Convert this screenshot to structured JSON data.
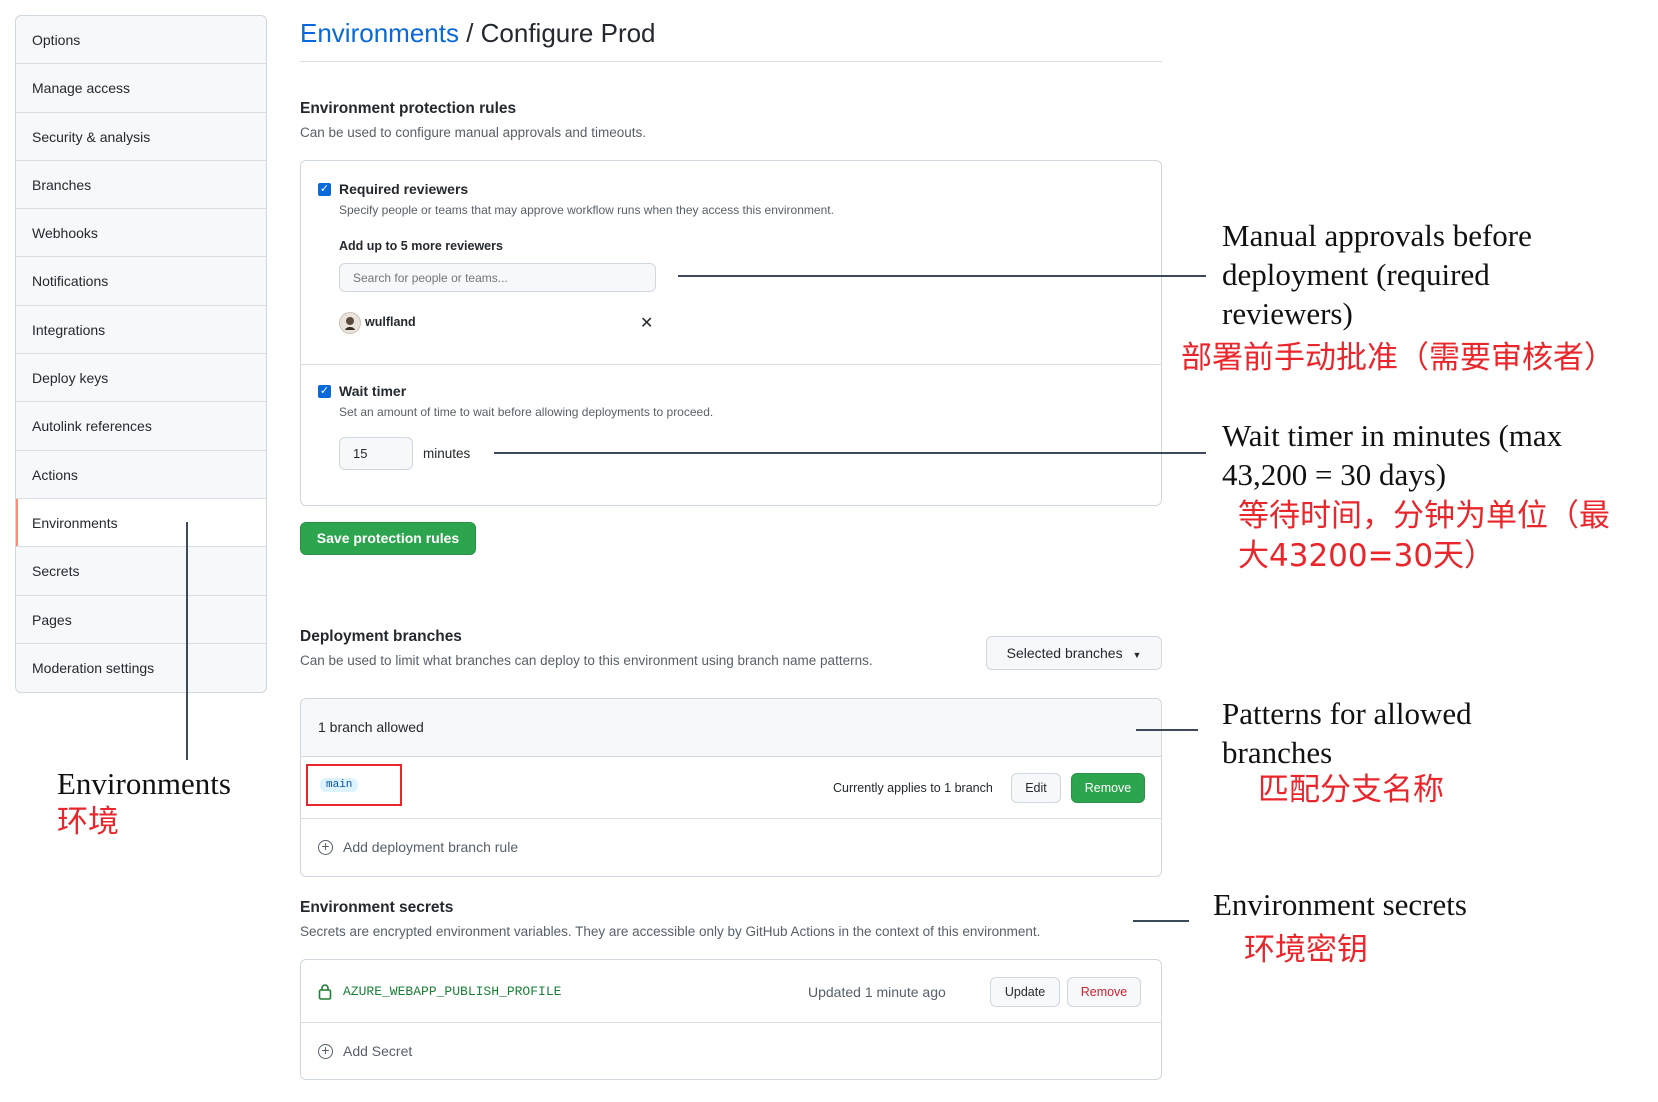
{
  "sidebar": {
    "items": [
      {
        "label": "Options"
      },
      {
        "label": "Manage access"
      },
      {
        "label": "Security & analysis"
      },
      {
        "label": "Branches"
      },
      {
        "label": "Webhooks"
      },
      {
        "label": "Notifications"
      },
      {
        "label": "Integrations"
      },
      {
        "label": "Deploy keys"
      },
      {
        "label": "Autolink references"
      },
      {
        "label": "Actions"
      },
      {
        "label": "Environments"
      },
      {
        "label": "Secrets"
      },
      {
        "label": "Pages"
      },
      {
        "label": "Moderation settings"
      }
    ],
    "active": "Environments"
  },
  "header": {
    "link": "Environments",
    "separator": " / ",
    "title": "Configure Prod"
  },
  "protection": {
    "heading": "Environment protection rules",
    "description": "Can be used to configure manual approvals and timeouts.",
    "reviewers": {
      "label": "Required reviewers",
      "checked": true,
      "description": "Specify people or teams that may approve workflow runs when they access this environment.",
      "add_label": "Add up to 5 more reviewers",
      "search_placeholder": "Search for people or teams...",
      "reviewer": "wulfland"
    },
    "wait_timer": {
      "label": "Wait timer",
      "checked": true,
      "description": "Set an amount of time to wait before allowing deployments to proceed.",
      "value": "15",
      "unit": "minutes"
    },
    "save_label": "Save protection rules"
  },
  "branches": {
    "heading": "Deployment branches",
    "description": "Can be used to limit what branches can deploy to this environment using branch name patterns.",
    "dropdown": "Selected branches",
    "count": "1 branch allowed",
    "rule": {
      "pattern": "main",
      "applies": "Currently applies to 1 branch",
      "edit": "Edit",
      "remove": "Remove"
    },
    "add": "Add deployment branch rule"
  },
  "secrets": {
    "heading": "Environment secrets",
    "description": "Secrets are encrypted environment variables. They are accessible only by GitHub Actions in the context of this environment.",
    "secret": {
      "name": "AZURE_WEBAPP_PUBLISH_PROFILE",
      "updated": "Updated 1 minute ago",
      "update": "Update",
      "remove": "Remove"
    },
    "add": "Add Secret"
  },
  "annotations": {
    "reviewers": {
      "en": [
        "Manual approvals before",
        "deployment (required",
        "reviewers)"
      ],
      "zh": "部署前手动批准（需要审核者）"
    },
    "wait_timer": {
      "en": [
        "Wait timer in minutes (max",
        "43,200 = 30 days)"
      ],
      "zh": [
        "等待时间，分钟为单位（最",
        "大43200=30天）"
      ]
    },
    "branches": {
      "en": [
        "Patterns for allowed",
        "branches"
      ],
      "zh": "匹配分支名称"
    },
    "secrets": {
      "en": "Environment secrets",
      "zh": "环境密钥"
    },
    "environments": {
      "en": "Environments",
      "zh": "环境"
    }
  },
  "colors": {
    "link": "#0969da",
    "green": "#2da44e",
    "annotation_red": "#e8262b",
    "highlight_box": "#e8262b",
    "active_marker": "#fd8c73"
  }
}
